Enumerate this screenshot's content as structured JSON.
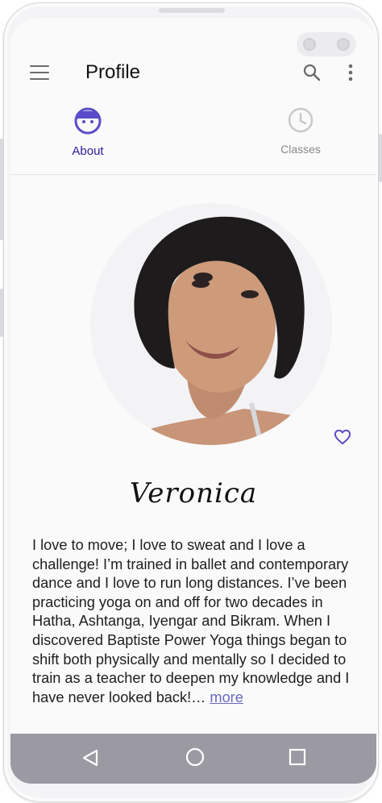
{
  "header": {
    "title": "Profile"
  },
  "tabs": [
    {
      "label": "About",
      "icon": "face-icon",
      "active": true
    },
    {
      "label": "Classes",
      "icon": "clock-icon",
      "active": false
    }
  ],
  "profile": {
    "name": "Veronica",
    "bio": "I love to move; I love to sweat and I love a challenge! I’m trained in ballet and contemporary dance and I love to run long distances. I’ve been practicing yoga on and off for two decades in Hatha, Ashtanga, Iyengar and Bikram. When I discovered Baptiste Power Yoga things began to shift both physically and mentally so I decided to train as a teacher to deepen my knowledge and I have never looked back!…",
    "more_label": "more"
  },
  "colors": {
    "accent": "#2b1a9e",
    "tab_icon_active": "#5a4cc9",
    "nav_bar": "#9b9aa3"
  }
}
